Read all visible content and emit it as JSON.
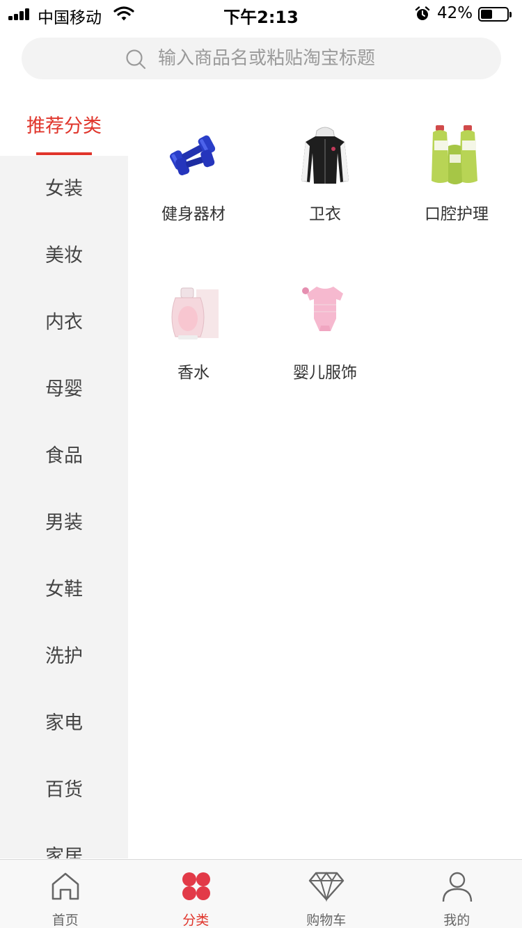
{
  "status_bar": {
    "carrier": "中国移动",
    "time": "下午2:13",
    "battery": "42%"
  },
  "search": {
    "placeholder": "输入商品名或粘贴淘宝标题"
  },
  "sidebar": {
    "active": "推荐分类",
    "items": [
      "女装",
      "美妆",
      "内衣",
      "母婴",
      "食品",
      "男装",
      "女鞋",
      "洗护",
      "家电",
      "百货",
      "家居"
    ]
  },
  "grid": {
    "items": [
      {
        "label": "健身器材",
        "icon": "dumbbell-icon"
      },
      {
        "label": "卫衣",
        "icon": "hoodie-icon"
      },
      {
        "label": "口腔护理",
        "icon": "mouthwash-icon"
      },
      {
        "label": "香水",
        "icon": "perfume-icon"
      },
      {
        "label": "婴儿服饰",
        "icon": "baby-romper-icon"
      }
    ]
  },
  "tabs": [
    {
      "label": "首页",
      "icon": "home-icon"
    },
    {
      "label": "分类",
      "icon": "category-icon"
    },
    {
      "label": "购物车",
      "icon": "diamond-icon"
    },
    {
      "label": "我的",
      "icon": "user-icon"
    }
  ],
  "colors": {
    "accent": "#e0352b",
    "sidebar_bg": "#f3f3f3",
    "tabbar_bg": "#f8f8f8"
  }
}
